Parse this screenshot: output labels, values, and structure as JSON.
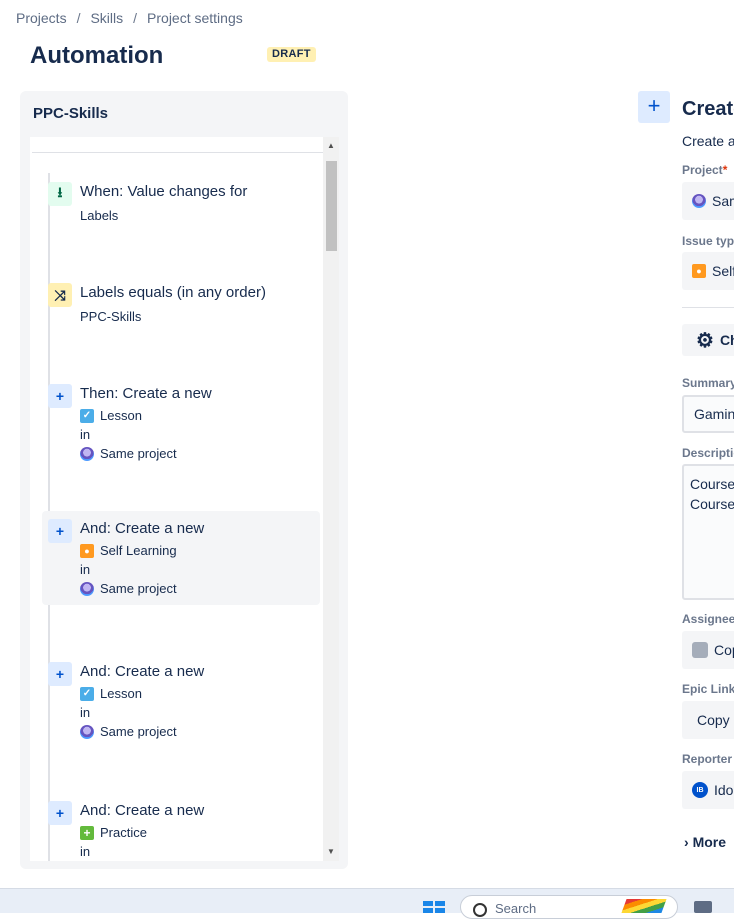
{
  "breadcrumb": [
    "Projects",
    "Skills",
    "Project settings"
  ],
  "breadcrumb_sep": "/",
  "title": "Automation",
  "status_badge": "DRAFT",
  "rule_panel": {
    "title": "PPC-Skills",
    "steps": [
      {
        "icon": "trigger-icon",
        "header": "When: Value changes for",
        "lines": [
          "Labels"
        ]
      },
      {
        "icon": "condition-icon",
        "header": "Labels equals (in any order)",
        "lines": [
          "PPC-Skills"
        ]
      },
      {
        "icon": "plus-icon",
        "header": "Then: Create a new",
        "issue_type": "Lesson",
        "in": "in",
        "project": "Same project"
      },
      {
        "icon": "plus-icon",
        "header": "And: Create a new",
        "issue_type": "Self Learning",
        "in": "in",
        "project": "Same project",
        "selected": true
      },
      {
        "icon": "plus-icon",
        "header": "And: Create a new",
        "issue_type": "Lesson",
        "in": "in",
        "project": "Same project"
      },
      {
        "icon": "plus-icon",
        "header": "And: Create a new",
        "issue_type": "Practice",
        "in": "in"
      }
    ]
  },
  "details": {
    "title": "Create",
    "subtitle": "Create a",
    "project_label": "Project",
    "required_mark": "*",
    "project_value": "Sam",
    "issue_type_label": "Issue type",
    "issue_type_value": "Self",
    "choose_fields": "Ch",
    "summary_label": "Summary",
    "summary_value": "Gaming",
    "description_label": "Description",
    "description_lines": [
      "Course",
      "Course"
    ],
    "assignee_label": "Assignee",
    "assignee_value": "Cop",
    "epic_link_label": "Epic Link",
    "epic_link_value": "Copy",
    "reporter_label": "Reporter",
    "reporter_avatar": "IB",
    "reporter_value": "Ido",
    "more": "More"
  },
  "taskbar": {
    "search_placeholder": "Search"
  },
  "colors": {
    "accent": "#0052cc",
    "draft_bg": "#fff0b3",
    "panel_bg": "#f4f5f7"
  }
}
